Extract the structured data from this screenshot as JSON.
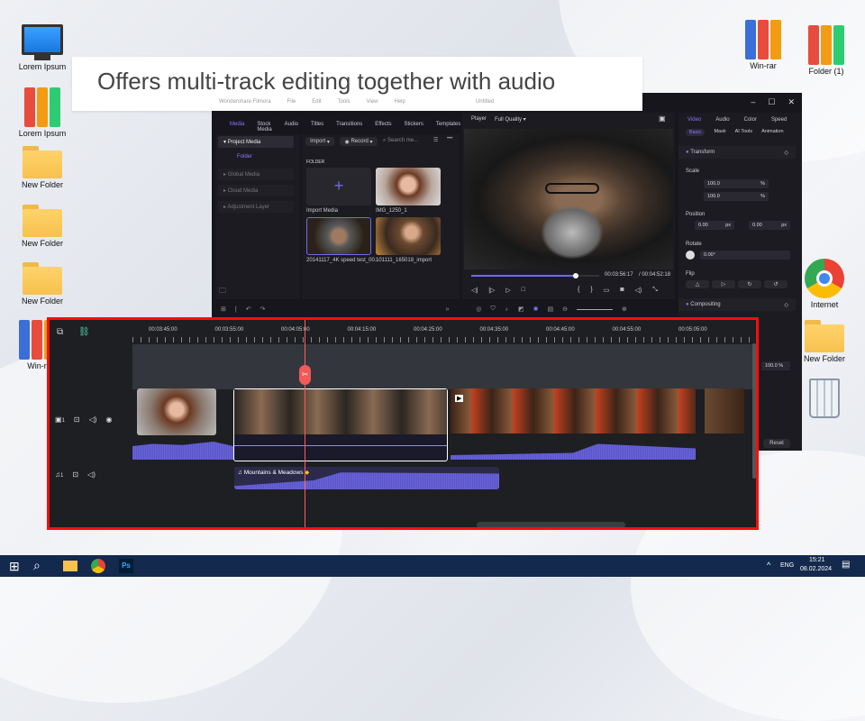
{
  "banner": {
    "text": "Offers multi-track editing together with audio"
  },
  "desktop": {
    "left_icons": [
      {
        "label": "Lorem Ipsum"
      },
      {
        "label": "Lorem Ipsum"
      },
      {
        "label": "New Folder"
      },
      {
        "label": "New Folder"
      },
      {
        "label": "New Folder"
      },
      {
        "label": "Win-r"
      }
    ],
    "right_icons": [
      {
        "label": "Win-rar"
      },
      {
        "label": "Folder (1)"
      },
      {
        "label": "Internet"
      },
      {
        "label": "New Folder"
      },
      {
        "label": "Recycle Bin"
      }
    ]
  },
  "app": {
    "title": "Wondershare Filmora",
    "project": "Untitled",
    "menu": [
      "File",
      "Edit",
      "Tools",
      "View",
      "Help"
    ],
    "media_tabs": [
      "Media",
      "Stock Media",
      "Audio",
      "Titles",
      "Transitions",
      "Effects",
      "Stickers",
      "Templates"
    ],
    "sidebar": {
      "project_media": "Project Media",
      "folder": "Folder",
      "items": [
        "Global Media",
        "Cloud Media",
        "Adjustment Layer"
      ]
    },
    "toolbar": {
      "import": "Import",
      "record": "Record",
      "search_placeholder": "Search me..."
    },
    "folder_label": "FOLDER",
    "media_items": [
      {
        "name": "Import Media"
      },
      {
        "name": "IMG_1250_1"
      },
      {
        "name": "20141117_4K speed test_00..."
      },
      {
        "name": "101111_165018_import"
      }
    ],
    "player": {
      "label": "Player",
      "quality": "Full Quality",
      "current_time": "00:03:56:17",
      "total_time": "/ 00:04:52:18",
      "progress": 0.82
    },
    "props": {
      "tabs": [
        "Video",
        "Audio",
        "Color",
        "Speed"
      ],
      "subtabs": [
        "Basic",
        "Mask",
        "AI Tools",
        "Animation"
      ],
      "transform": "Transform",
      "scale": "Scale",
      "scale_x": "100.0",
      "scale_y": "100.0",
      "pct": "%",
      "position": "Position",
      "pos_x": "0.00",
      "pos_y": "0.00",
      "px": "px",
      "rotate": "Rotate",
      "rotate_val": "0.00°",
      "flip": "Flip",
      "compositing": "Compositing",
      "opacity": "100.0",
      "reset": "Reset"
    }
  },
  "timeline": {
    "ticks": [
      "00:03:45:00",
      "00:03:55:00",
      "00:04:05:00",
      "00:04:15:00",
      "00:04:25:00",
      "00:04:35:00",
      "00:04:45:00",
      "00:04:55:00",
      "00:05:05:00"
    ],
    "video_track": "1",
    "audio_track": "1",
    "audio_clip": "Mountains & Meadows"
  },
  "taskbar": {
    "lang": "ENG",
    "time": "15:21",
    "date": "08.02.2024"
  }
}
